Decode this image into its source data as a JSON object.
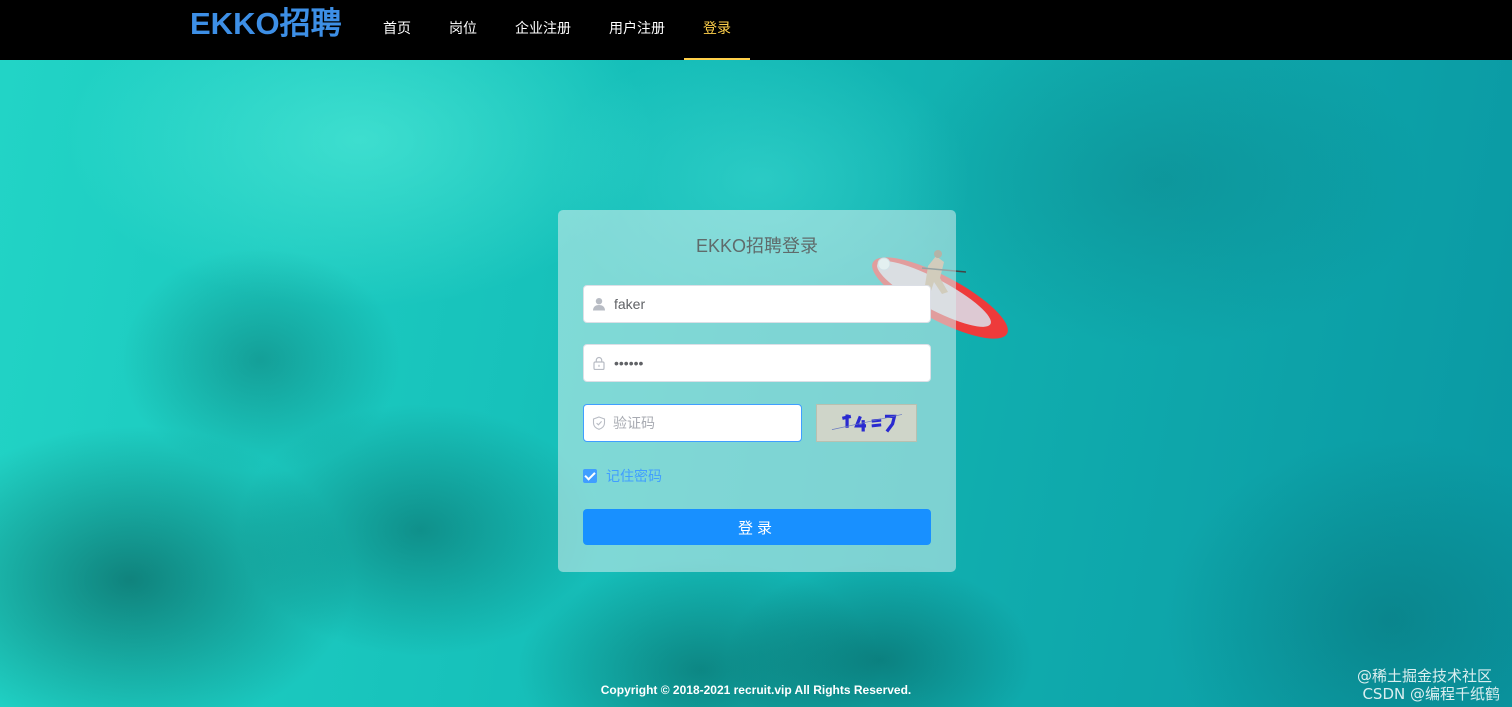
{
  "header": {
    "logo_text": "EKKO招聘",
    "nav": [
      {
        "label": "首页",
        "active": false
      },
      {
        "label": "岗位",
        "active": false
      },
      {
        "label": "企业注册",
        "active": false
      },
      {
        "label": "用户注册",
        "active": false
      },
      {
        "label": "登录",
        "active": true
      }
    ]
  },
  "login": {
    "title": "EKKO招聘登录",
    "username_value": "faker",
    "password_value": "••••••",
    "captcha_placeholder": "验证码",
    "captcha_image_text": "ヤ4=ワ",
    "remember_label": "记住密码",
    "remember_checked": true,
    "submit_label": "登录"
  },
  "footer": {
    "copyright": "Copyright © 2018-2021 recruit.vip All Rights Reserved."
  },
  "watermarks": {
    "line1": "@稀土掘金技术社区",
    "line2": "CSDN @编程千纸鹤"
  },
  "colors": {
    "nav_bg": "#000000",
    "nav_active": "#ffd04b",
    "logo": "#3d8fe6",
    "primary": "#1890ff"
  }
}
